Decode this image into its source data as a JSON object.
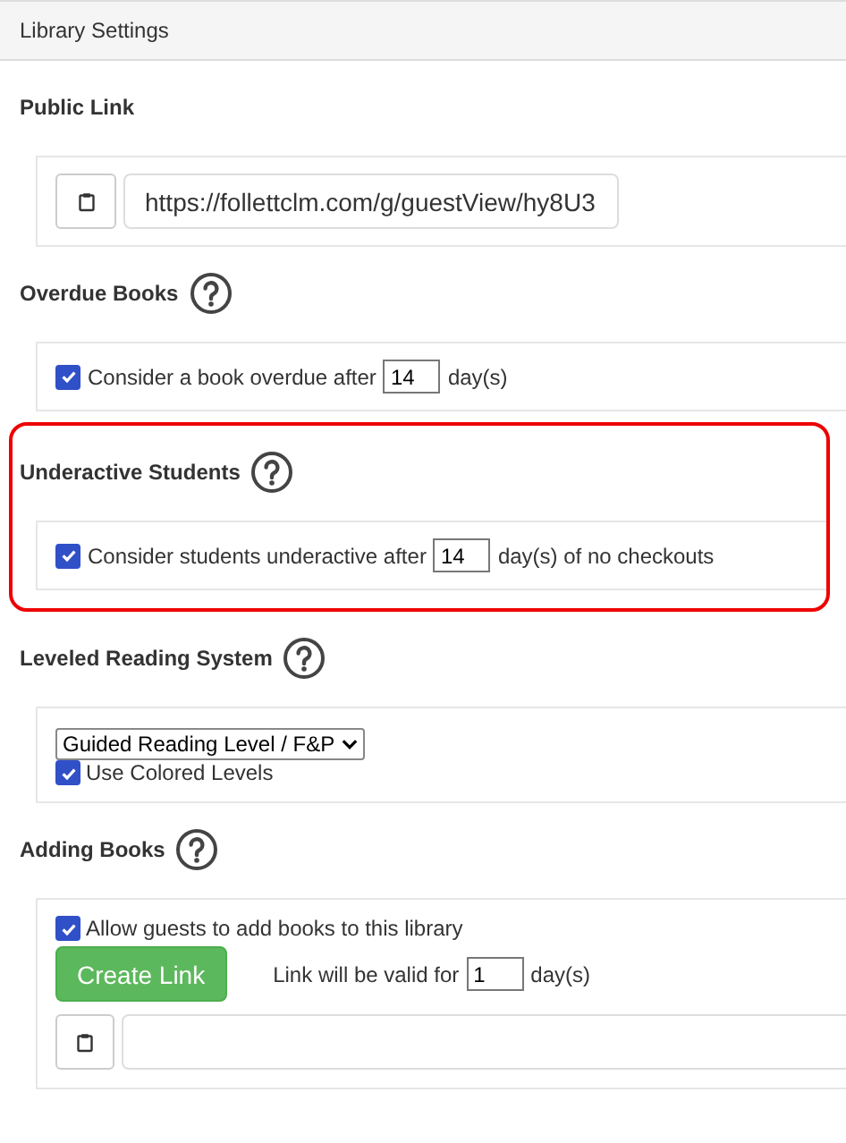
{
  "header": {
    "title": "Library Settings"
  },
  "sections": [
    {
      "kind": "link",
      "title": "Public Link",
      "help": false,
      "highlighted": false,
      "url": "https://follettclm.com/g/guestView/hy8U3"
    },
    {
      "kind": "days",
      "title": "Overdue Books",
      "help": true,
      "highlighted": false,
      "checked": true,
      "label": "Consider a book overdue after",
      "value": "14",
      "after": "day(s)"
    },
    {
      "kind": "days",
      "title": "Underactive Students",
      "help": true,
      "highlighted": true,
      "checked": true,
      "label": "Consider students underactive after",
      "value": "14",
      "after": "day(s) of no checkouts"
    },
    {
      "kind": "select",
      "title": "Leveled Reading System",
      "help": true,
      "highlighted": false,
      "select": "Guided Reading Level / F&P",
      "checked": true,
      "label": "Use Colored Levels"
    },
    {
      "kind": "adding",
      "title": "Adding Books",
      "help": true,
      "highlighted": false,
      "checked": true,
      "label": "Allow guests to add books to this library",
      "button": "Create Link",
      "valid_label": "Link will be valid for",
      "value": "1",
      "after": "day(s)"
    }
  ]
}
